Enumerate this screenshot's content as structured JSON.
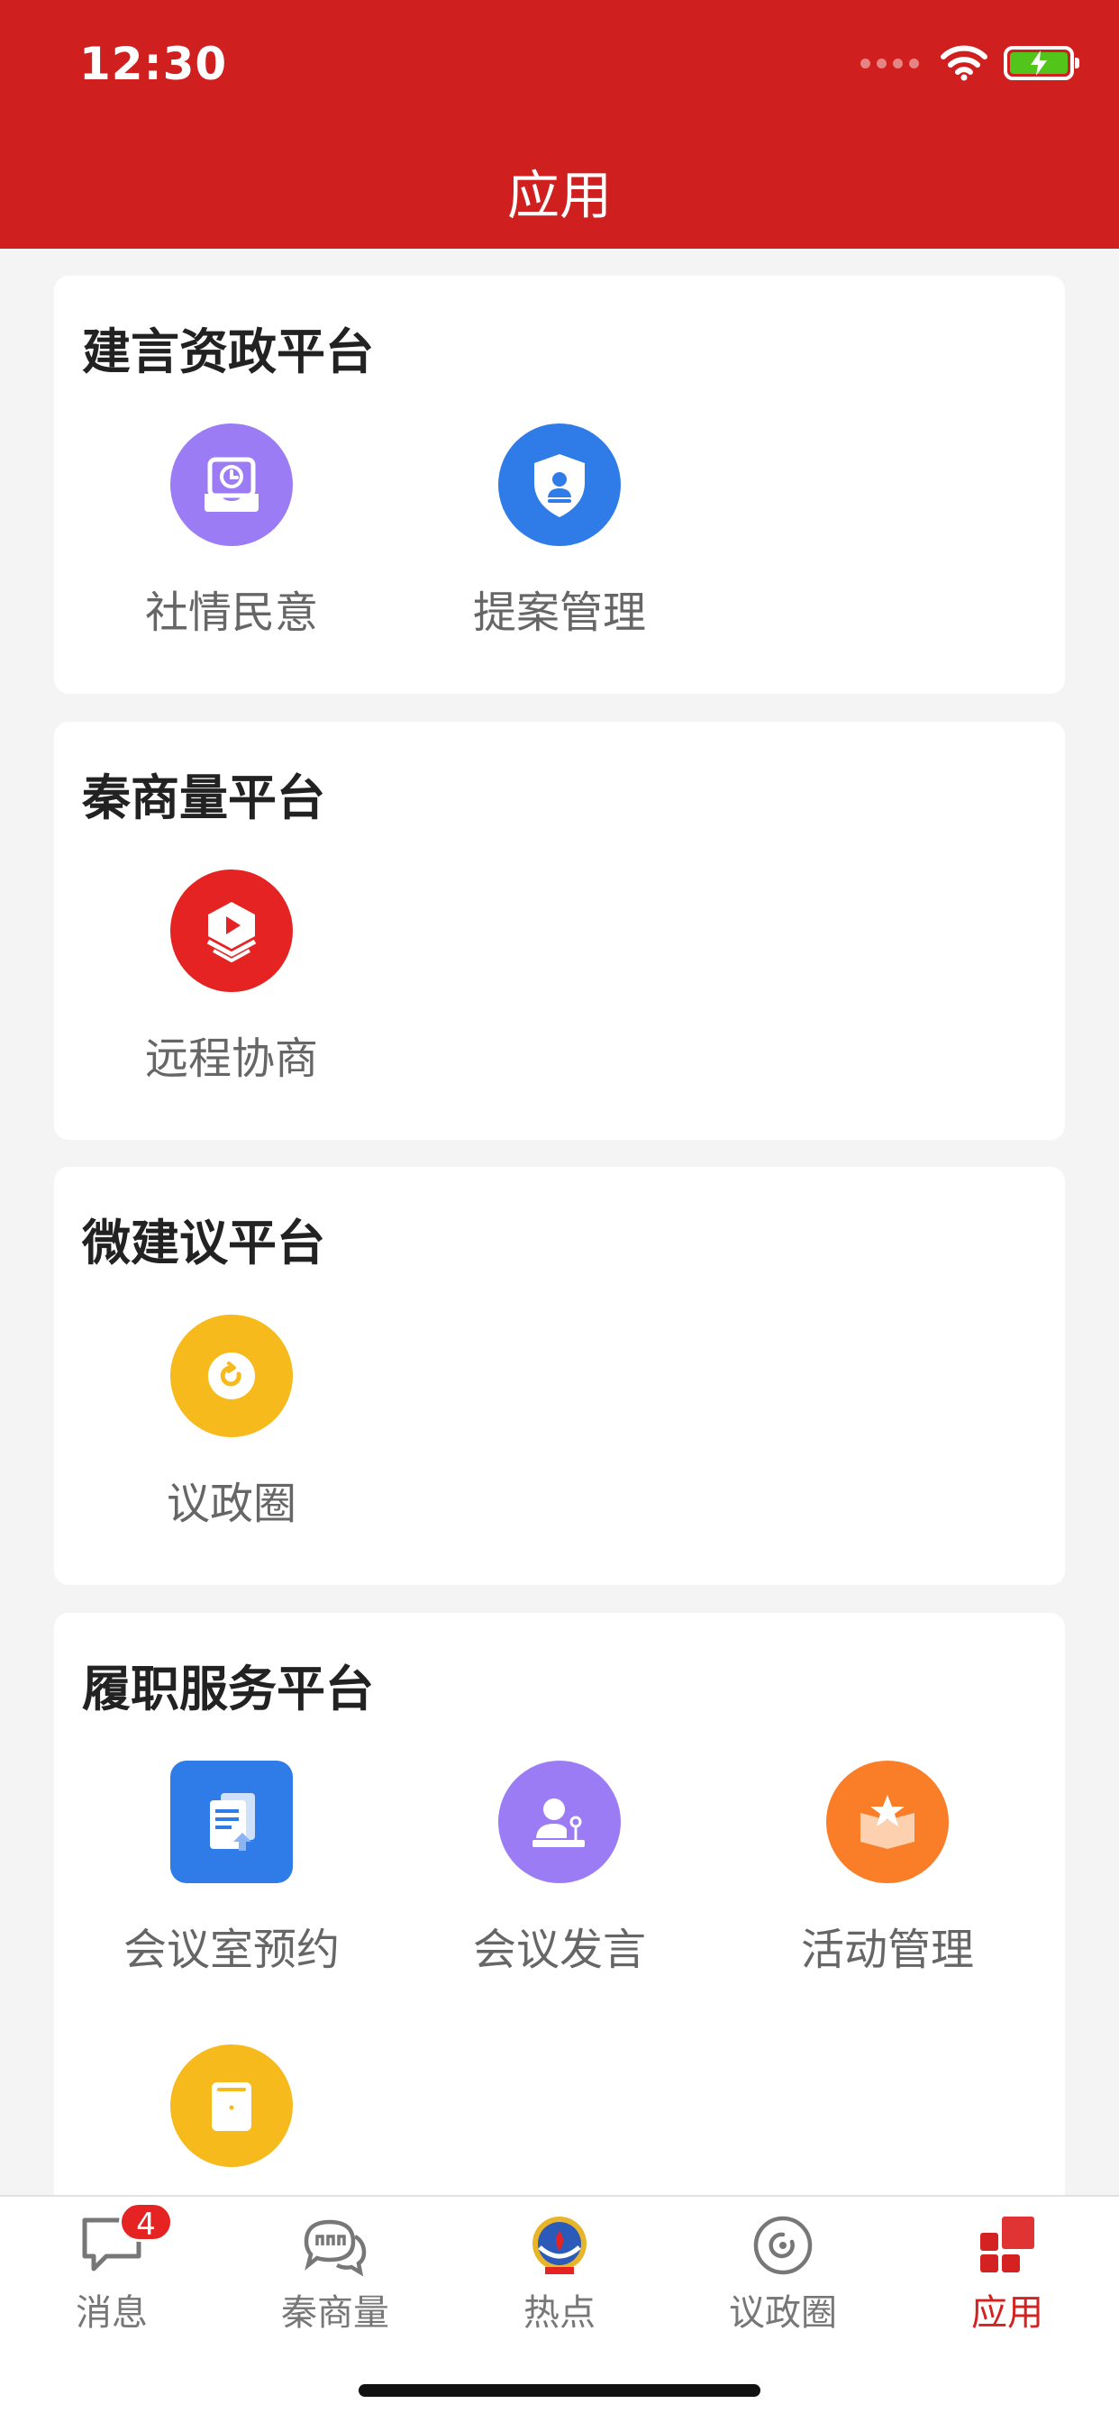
{
  "status": {
    "time": "12:30"
  },
  "header": {
    "title": "应用"
  },
  "sections": [
    {
      "title": "建言资政平台",
      "apps": [
        {
          "label": "社情民意",
          "icon": "inbox-clock-icon"
        },
        {
          "label": "提案管理",
          "icon": "shield-user-icon"
        }
      ]
    },
    {
      "title": "秦商量平台",
      "apps": [
        {
          "label": "远程协商",
          "icon": "video-cube-icon"
        }
      ]
    },
    {
      "title": "微建议平台",
      "apps": [
        {
          "label": "议政圈",
          "icon": "circle-refresh-icon"
        }
      ]
    },
    {
      "title": "履职服务平台",
      "apps": [
        {
          "label": "会议室预约",
          "icon": "document-upload-icon"
        },
        {
          "label": "会议发言",
          "icon": "speaker-podium-icon"
        },
        {
          "label": "活动管理",
          "icon": "star-box-icon"
        },
        {
          "label": "",
          "icon": "folder-icon"
        }
      ]
    }
  ],
  "tabbar": {
    "messages": {
      "label": "消息",
      "badge": "4"
    },
    "qinshangliang": {
      "label": "秦商量"
    },
    "hot": {
      "label": "热点"
    },
    "yizhengquan": {
      "label": "议政圈"
    },
    "apps": {
      "label": "应用"
    }
  },
  "colors": {
    "header": "#cf1f1f",
    "purple": "#9b7cf5",
    "blue": "#2f7be8",
    "red": "#e62323",
    "yellow": "#f6ba1c",
    "orange": "#fa7d28",
    "active_tab": "#d42121"
  }
}
